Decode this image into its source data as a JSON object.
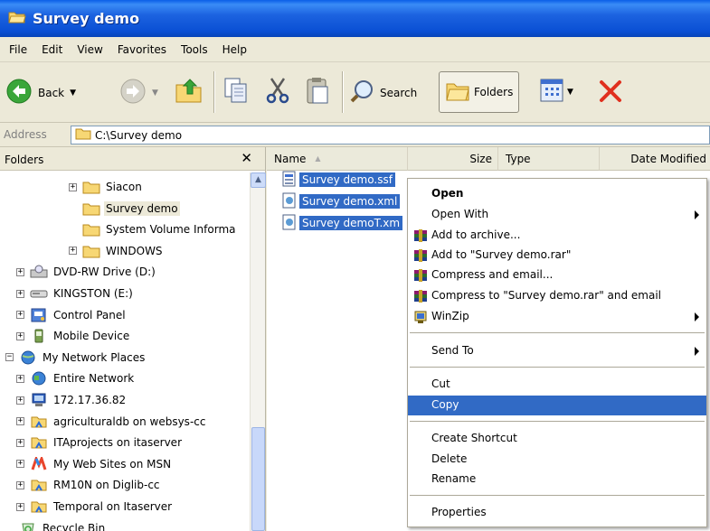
{
  "window": {
    "title": "Survey demo"
  },
  "menu": [
    "File",
    "Edit",
    "View",
    "Favorites",
    "Tools",
    "Help"
  ],
  "toolbar": {
    "back": "Back",
    "search": "Search",
    "folders": "Folders"
  },
  "address": {
    "label": "Address",
    "value": "C:\\Survey demo"
  },
  "folders_pane": {
    "title": "Folders",
    "items": [
      {
        "label": "Siacon",
        "icon": "folder-icon",
        "expander": "+"
      },
      {
        "label": "Survey demo",
        "icon": "folder-icon",
        "expander": "",
        "selected": true
      },
      {
        "label": "System Volume Informa",
        "icon": "folder-icon",
        "expander": ""
      },
      {
        "label": "WINDOWS",
        "icon": "folder-icon",
        "expander": "+"
      },
      {
        "label": "DVD-RW Drive (D:)",
        "icon": "dvd-drive-icon",
        "expander": "+"
      },
      {
        "label": "KINGSTON (E:)",
        "icon": "removable-drive-icon",
        "expander": "+"
      },
      {
        "label": "Control Panel",
        "icon": "control-panel-icon",
        "expander": "+"
      },
      {
        "label": "Mobile Device",
        "icon": "mobile-device-icon",
        "expander": "+"
      },
      {
        "label": "My Network Places",
        "icon": "network-places-icon",
        "expander": "−"
      },
      {
        "label": "Entire Network",
        "icon": "globe-icon",
        "expander": "+"
      },
      {
        "label": "172.17.36.82",
        "icon": "network-computer-icon",
        "expander": "+"
      },
      {
        "label": "agriculturaldb on websys-cc",
        "icon": "network-share-icon",
        "expander": "+"
      },
      {
        "label": "ITAprojects on itaserver",
        "icon": "network-share-icon",
        "expander": "+"
      },
      {
        "label": "My Web Sites on MSN",
        "icon": "msn-icon",
        "expander": "+"
      },
      {
        "label": "RM10N on Diglib-cc",
        "icon": "network-share-icon",
        "expander": "+"
      },
      {
        "label": "Temporal on Itaserver",
        "icon": "network-share-icon",
        "expander": "+"
      },
      {
        "label": "Recycle Bin",
        "icon": "recycle-bin-icon",
        "expander": ""
      }
    ]
  },
  "columns": [
    "Name",
    "Size",
    "Type",
    "Date Modified"
  ],
  "files": [
    {
      "name": "Survey demo.ssf",
      "icon": "ssf-file-icon"
    },
    {
      "name": "Survey demo.xml",
      "icon": "xml-file-icon"
    },
    {
      "name": "Survey demoT.xm",
      "icon": "xml-file-icon"
    }
  ],
  "context_menu": {
    "items": [
      {
        "label": "Open",
        "bold": true
      },
      {
        "label": "Open With",
        "submenu": true
      },
      {
        "label": "Add to archive...",
        "icon": "winrar-icon"
      },
      {
        "label": "Add to \"Survey demo.rar\"",
        "icon": "winrar-icon"
      },
      {
        "label": "Compress and email...",
        "icon": "winrar-icon"
      },
      {
        "label": "Compress to \"Survey demo.rar\" and email",
        "icon": "winrar-icon"
      },
      {
        "label": "WinZip",
        "icon": "winzip-icon",
        "submenu": true
      },
      {
        "label": "Send To",
        "submenu": true
      },
      {
        "label": "Cut"
      },
      {
        "label": "Copy",
        "highlighted": true
      },
      {
        "label": "Create Shortcut"
      },
      {
        "label": "Delete"
      },
      {
        "label": "Rename"
      },
      {
        "label": "Properties"
      }
    ]
  },
  "colors": {
    "title_bar": "#0a4fd4",
    "selection": "#316ac5",
    "window_bg": "#ece9d8"
  }
}
